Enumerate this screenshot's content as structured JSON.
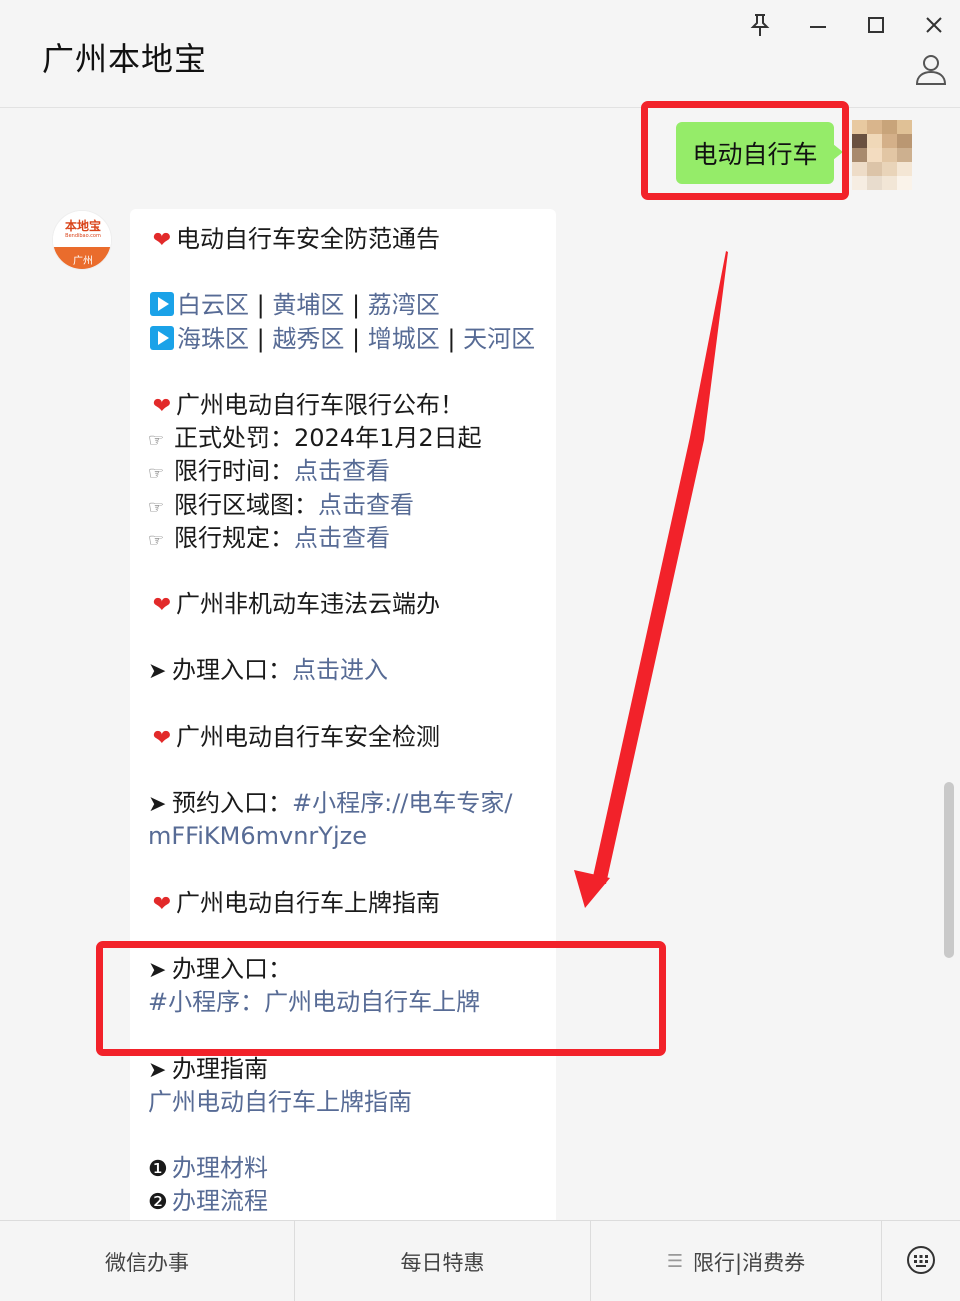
{
  "window": {
    "title": "广州本地宝"
  },
  "my_message": {
    "text": "电动自行车"
  },
  "oa_avatar": {
    "brand": "本地宝",
    "domain": "Bendibao.com",
    "city": "广州"
  },
  "message": {
    "heading1": "电动自行车安全防范通告",
    "districts_row1": [
      "白云区",
      "黄埔区",
      "荔湾区"
    ],
    "districts_row2": [
      "海珠区",
      "越秀区",
      "增城区",
      "天河区"
    ],
    "separator": "|",
    "heading2": "广州电动自行车限行公布！",
    "penalty_label": "正式处罚：",
    "penalty_value": "2024年1月2日起",
    "time_label": "限行时间：",
    "area_label": "限行区域图：",
    "rule_label": "限行规定：",
    "view_link": "点击查看",
    "heading3": "广州非机动车违法云端办",
    "entry_label": "办理入口：",
    "enter_link": "点击进入",
    "heading4": "广州电动自行车安全检测",
    "booking_label": "预约入口：",
    "booking_link_1": "#小程序://电车专家/",
    "booking_link_2": "mFFiKM6mvnrYjze",
    "heading5": "广州电动自行车上牌指南",
    "plate_entry_label": "办理入口：",
    "plate_entry_link": "#小程序：广州电动自行车上牌",
    "guide_label": "办理指南",
    "guide_link": "广州电动自行车上牌指南",
    "num1": "❶",
    "item1_link": "办理材料",
    "num2": "❷",
    "item2_link": "办理流程"
  },
  "glyphs": {
    "heart": "❤",
    "hand": "☞",
    "arrow": "➤"
  },
  "bottom_menu": [
    {
      "label": "微信办事"
    },
    {
      "label": "每日特惠"
    },
    {
      "label": "限行|消费券"
    }
  ],
  "colors": {
    "link": "#576b95",
    "my_bubble": "#95ec69",
    "annotation": "#f2222a"
  }
}
